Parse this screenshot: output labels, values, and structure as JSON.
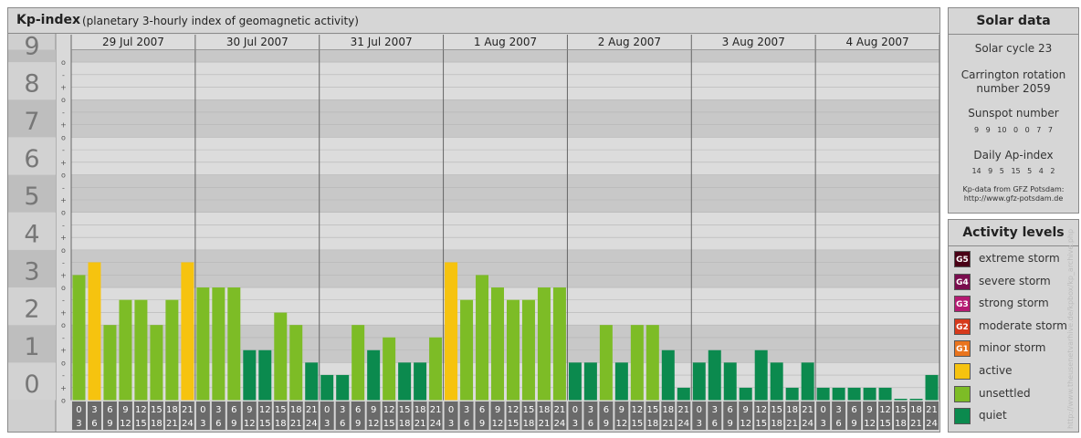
{
  "header": {
    "title": "Kp-index",
    "subtitle": "(planetary 3-hourly index of geomagnetic activity)"
  },
  "chart_data": {
    "type": "bar",
    "title": "Kp-index",
    "subtitle": "(planetary 3-hourly index of geomagnetic activity)",
    "ylim": [
      0,
      9.33
    ],
    "y_major_labels": [
      "0",
      "1",
      "2",
      "3",
      "4",
      "5",
      "6",
      "7",
      "8",
      "9"
    ],
    "y_minor_labels": [
      "o",
      "+",
      "-"
    ],
    "days": [
      "29 Jul 2007",
      "30 Jul 2007",
      "31 Jul 2007",
      "1 Aug 2007",
      "2 Aug 2007",
      "3 Aug 2007",
      "4 Aug 2007"
    ],
    "interval_start_hours": [
      "0",
      "3",
      "6",
      "9",
      "12",
      "15",
      "18",
      "21"
    ],
    "interval_end_hours": [
      "3",
      "6",
      "9",
      "12",
      "15",
      "18",
      "21",
      "24"
    ],
    "values": [
      3.33,
      3.67,
      2.0,
      2.67,
      2.67,
      2.0,
      2.67,
      3.67,
      3.0,
      3.0,
      3.0,
      1.33,
      1.33,
      2.33,
      2.0,
      1.0,
      0.67,
      0.67,
      2.0,
      1.33,
      1.67,
      1.0,
      1.0,
      1.67,
      3.67,
      2.67,
      3.33,
      3.0,
      2.67,
      2.67,
      3.0,
      3.0,
      1.0,
      1.0,
      2.0,
      1.0,
      2.0,
      2.0,
      1.33,
      0.33,
      1.0,
      1.33,
      1.0,
      0.33,
      1.33,
      1.0,
      0.33,
      1.0,
      0.33,
      0.33,
      0.33,
      0.33,
      0.33,
      0.0,
      0.0,
      0.67
    ],
    "grid": true,
    "colors": {
      "quiet": "#0b8a4e",
      "unsettled": "#7dbc26",
      "active": "#f6c30f"
    }
  },
  "solar_data": {
    "title": "Solar data",
    "cycle": "Solar cycle 23",
    "rotation_line1": "Carrington rotation",
    "rotation_line2": "number 2059",
    "sunspot_title": "Sunspot number",
    "sunspot_values": "9 9 10 0 0 7 7",
    "ap_title": "Daily Ap-index",
    "ap_values": "14 9 5 15 5 4 2",
    "source_line1": "Kp-data from GFZ Potsdam:",
    "source_line2": "http://www.gfz-potsdam.de"
  },
  "activity_levels": {
    "title": "Activity levels",
    "items": [
      {
        "code": "G5",
        "label": "extreme storm",
        "color": "#4a0016"
      },
      {
        "code": "G4",
        "label": "severe storm",
        "color": "#7a0d4e"
      },
      {
        "code": "G3",
        "label": "strong storm",
        "color": "#b51a72"
      },
      {
        "code": "G2",
        "label": "moderate storm",
        "color": "#d63a1c"
      },
      {
        "code": "G1",
        "label": "minor storm",
        "color": "#e9741d"
      },
      {
        "code": "",
        "label": "active",
        "color": "#f6c30f"
      },
      {
        "code": "",
        "label": "unsettled",
        "color": "#7dbc26"
      },
      {
        "code": "",
        "label": "quiet",
        "color": "#0b8a4e"
      }
    ]
  },
  "watermark": "http://www.theusenetvarhive.de/kpbox/kp_archive.php"
}
